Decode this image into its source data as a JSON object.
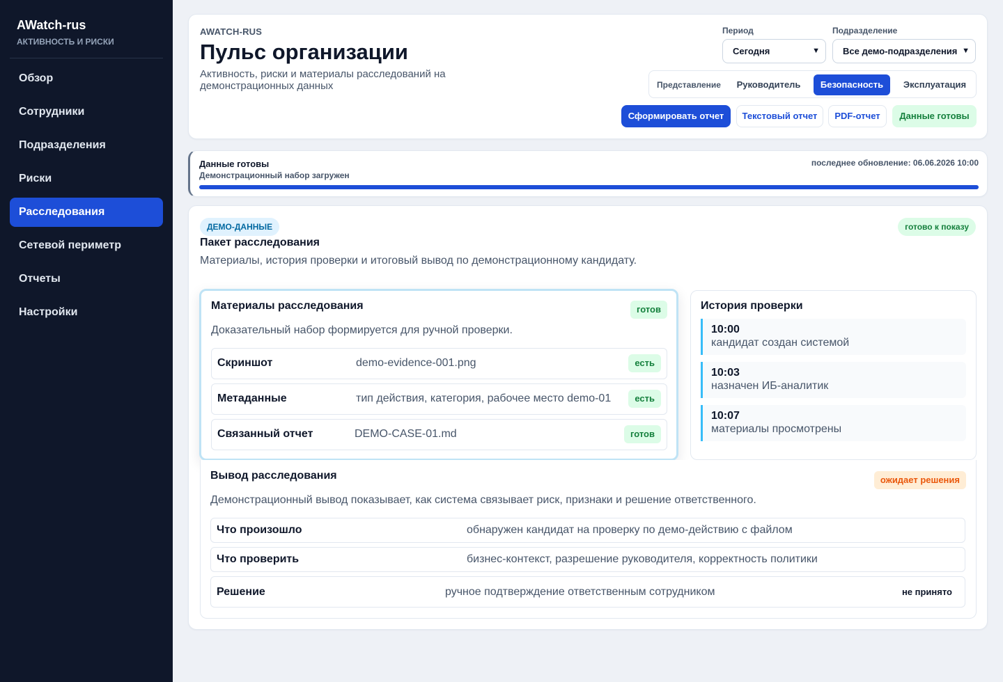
{
  "sidebar": {
    "brand": "AWatch-rus",
    "subtitle": "АКТИВНОСТЬ И РИСКИ",
    "items": [
      "Обзор",
      "Сотрудники",
      "Подразделения",
      "Риски",
      "Расследования",
      "Сетевой периметр",
      "Отчеты",
      "Настройки"
    ],
    "active": "Расследования"
  },
  "header": {
    "eyebrow": "AWATCH-RUS",
    "title": "Пульс организации",
    "subtitle": "Активность, риски и материалы расследований на демонстрационных данных",
    "period_label": "Период",
    "period_value": "Сегодня",
    "dept_label": "Подразделение",
    "dept_value": "Все демо-подразделения",
    "view_label": "Представление",
    "views": [
      "Руководитель",
      "Безопасность",
      "Эксплуатация"
    ],
    "active_view": "Безопасность",
    "btn_generate": "Сформировать отчет",
    "btn_text": "Текстовый отчет",
    "btn_pdf": "PDF-отчет",
    "btn_ready": "Данные готовы"
  },
  "status": {
    "title": "Данные готовы",
    "sub": "Демонстрационный набор загружен",
    "updated": "последнее обновление: 06.06.2026 10:00",
    "progress": 1.0
  },
  "package": {
    "badge": "ДЕМО-ДАННЫЕ",
    "ready_badge": "готово к показу",
    "title": "Пакет расследования",
    "subtitle": "Материалы, история проверки и итоговый вывод по демонстрационному кандидату."
  },
  "materials": {
    "title": "Материалы расследования",
    "tag": "готов",
    "desc": "Доказательный набор формируется для ручной проверки.",
    "rows": [
      {
        "key": "Скриншот",
        "value": "demo-evidence-001.png",
        "tag": "есть"
      },
      {
        "key": "Метаданные",
        "value": "тип действия, категория, рабочее место demo-01",
        "tag": "есть"
      },
      {
        "key": "Связанный отчет",
        "value": "DEMO-CASE-01.md",
        "tag": "готов"
      }
    ]
  },
  "history": {
    "title": "История проверки",
    "items": [
      {
        "time": "10:00",
        "text": "кандидат создан системой"
      },
      {
        "time": "10:03",
        "text": "назначен ИБ-аналитик"
      },
      {
        "time": "10:07",
        "text": "материалы просмотрены"
      }
    ]
  },
  "conclusion": {
    "title": "Вывод расследования",
    "tag": "ожидает решения",
    "desc": "Демонстрационный вывод показывает, как система связывает риск, признаки и решение ответственного.",
    "rows": [
      {
        "key": "Что произошло",
        "value": "обнаружен кандидат на проверку по демо-действию с файлом"
      },
      {
        "key": "Что проверить",
        "value": "бизнес-контекст, разрешение руководителя, корректность политики"
      },
      {
        "key": "Решение",
        "value": "ручное подтверждение ответственным сотрудником",
        "tag": "не принято"
      }
    ]
  },
  "colors": {
    "accent": "#1d4ed8",
    "sidebar_bg": "#0f172a",
    "success": "#15803d",
    "warning": "#ea580c"
  }
}
